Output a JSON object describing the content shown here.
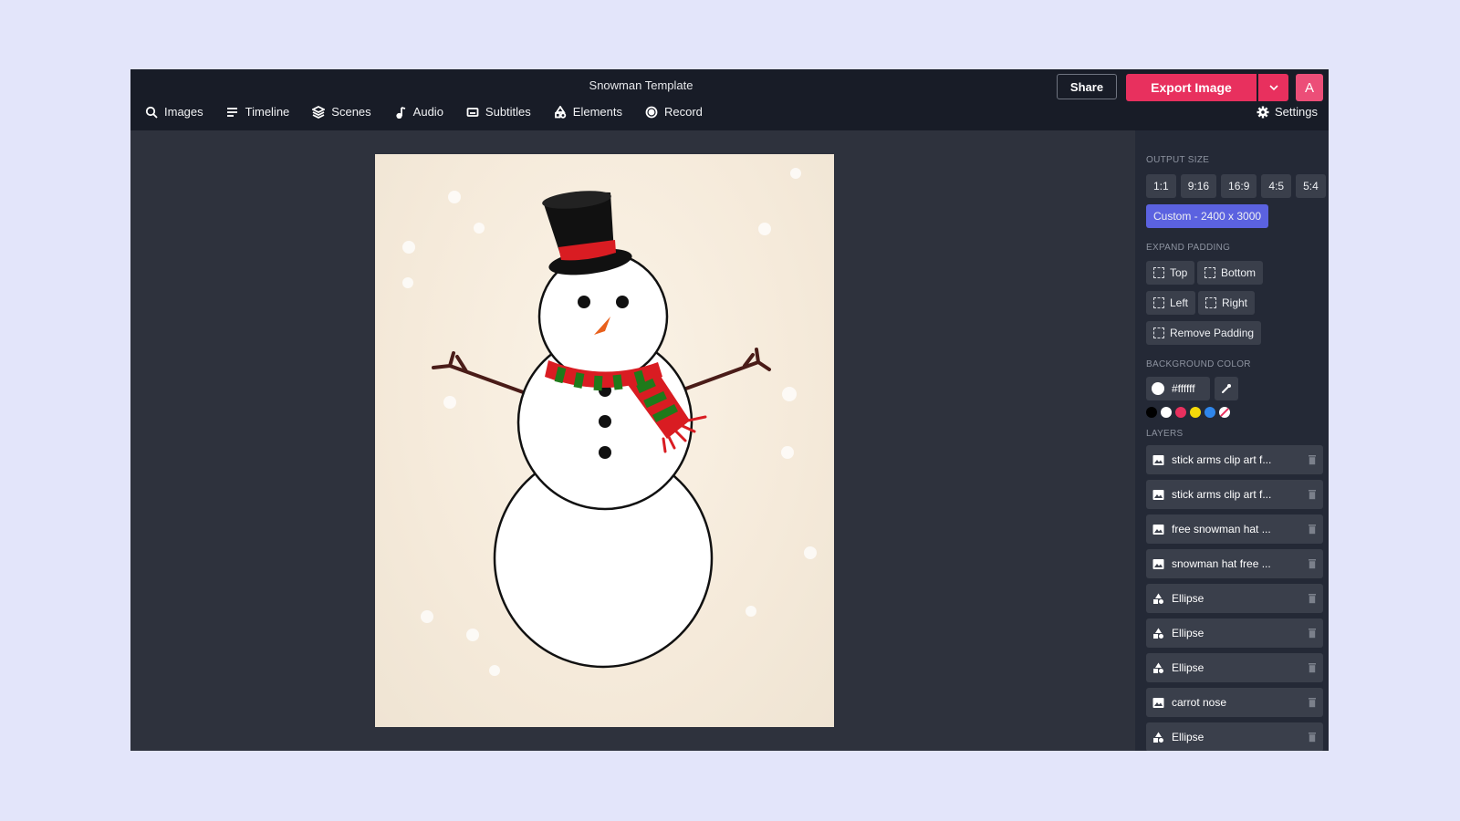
{
  "app": {
    "doc_title": "Snowman Template",
    "share_label": "Share",
    "export_label": "Export Image",
    "avatar_initial": "A",
    "accent": "#e8305e"
  },
  "menu": [
    {
      "label": "Images",
      "icon": "search-icon"
    },
    {
      "label": "Timeline",
      "icon": "timeline-icon"
    },
    {
      "label": "Scenes",
      "icon": "layers-icon"
    },
    {
      "label": "Audio",
      "icon": "music-note-icon"
    },
    {
      "label": "Subtitles",
      "icon": "subtitles-icon"
    },
    {
      "label": "Elements",
      "icon": "shapes-icon"
    },
    {
      "label": "Record",
      "icon": "record-icon"
    }
  ],
  "settings_label": "Settings",
  "panel": {
    "output_size_label": "OUTPUT SIZE",
    "ratios": [
      "1:1",
      "9:16",
      "16:9",
      "4:5",
      "5:4"
    ],
    "custom_size": "Custom - 2400 x 3000",
    "expand_padding_label": "EXPAND PADDING",
    "padding": {
      "top": "Top",
      "bottom": "Bottom",
      "left": "Left",
      "right": "Right",
      "remove": "Remove Padding"
    },
    "background_color_label": "BACKGROUND COLOR",
    "background_color_value": "#ffffff",
    "swatch_colors": [
      "#000000",
      "#ffffff",
      "#e8305e",
      "#f5d90a",
      "#2f86eb"
    ],
    "layers_label": "LAYERS",
    "layers": [
      {
        "name": "stick arms clip art f...",
        "type": "image"
      },
      {
        "name": "stick arms clip art f...",
        "type": "image"
      },
      {
        "name": "free snowman hat ...",
        "type": "image"
      },
      {
        "name": "snowman hat free ...",
        "type": "image"
      },
      {
        "name": "Ellipse",
        "type": "shape"
      },
      {
        "name": "Ellipse",
        "type": "shape"
      },
      {
        "name": "Ellipse",
        "type": "shape"
      },
      {
        "name": "carrot nose",
        "type": "image"
      },
      {
        "name": "Ellipse",
        "type": "shape"
      }
    ]
  }
}
